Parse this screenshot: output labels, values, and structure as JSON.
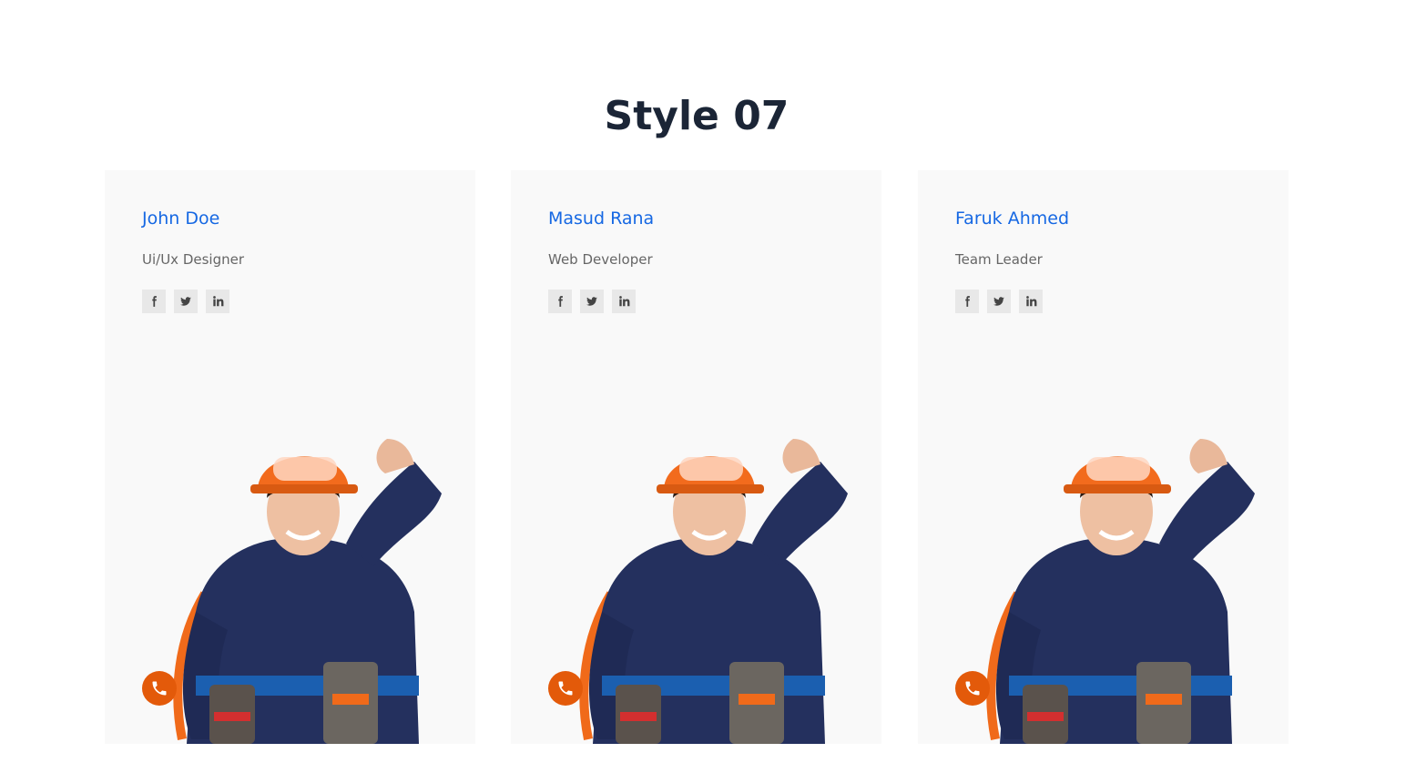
{
  "page": {
    "title": "Style 07"
  },
  "colors": {
    "name": "#1668e3",
    "accent": "#e35a0a",
    "title": "#1b2536",
    "card_bg": "#f9f9f9"
  },
  "team": [
    {
      "name": "John Doe",
      "role": "Ui/Ux Designer",
      "socials": [
        "facebook-icon",
        "twitter-icon",
        "linkedin-icon"
      ],
      "action_icon": "phone-icon"
    },
    {
      "name": "Masud Rana",
      "role": "Web Developer",
      "socials": [
        "facebook-icon",
        "twitter-icon",
        "linkedin-icon"
      ],
      "action_icon": "phone-icon"
    },
    {
      "name": "Faruk Ahmed",
      "role": "Team Leader",
      "socials": [
        "facebook-icon",
        "twitter-icon",
        "linkedin-icon"
      ],
      "action_icon": "phone-icon"
    }
  ]
}
